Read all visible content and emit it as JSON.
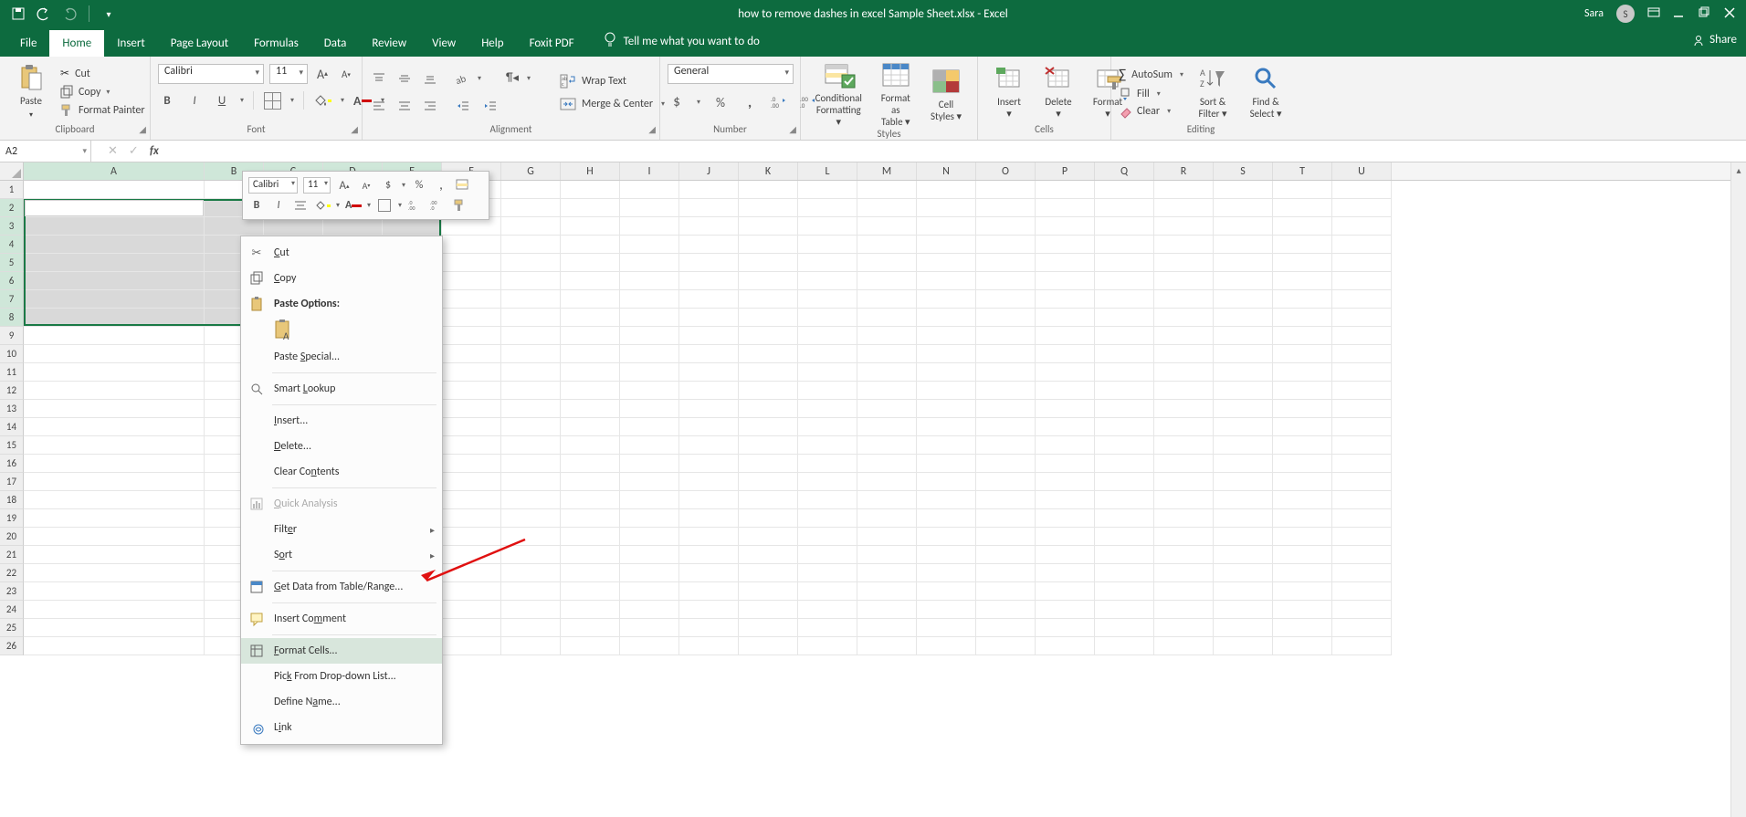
{
  "title": "how to remove dashes in excel Sample Sheet.xlsx  -  Excel",
  "user": {
    "name": "Sara",
    "initial": "S"
  },
  "tabs": [
    "File",
    "Home",
    "Insert",
    "Page Layout",
    "Formulas",
    "Data",
    "Review",
    "View",
    "Help",
    "Foxit PDF"
  ],
  "active_tab": "Home",
  "tell_me": "Tell me what you want to do",
  "share": "Share",
  "ribbon": {
    "paste": "Paste",
    "cut": "Cut",
    "copy": "Copy",
    "format_painter": "Format Painter",
    "clipboard_group": "Clipboard",
    "font_name": "Calibri",
    "font_size": "11",
    "font_group": "Font",
    "wrap": "Wrap Text",
    "merge": "Merge & Center",
    "alignment_group": "Alignment",
    "number_format": "General",
    "number_group": "Number",
    "cond_fmt_l1": "Conditional",
    "cond_fmt_l2": "Formatting",
    "fmt_table_l1": "Format as",
    "fmt_table_l2": "Table",
    "cell_styles_l1": "Cell",
    "cell_styles_l2": "Styles",
    "styles_group": "Styles",
    "insert": "Insert",
    "delete": "Delete",
    "format": "Format",
    "cells_group": "Cells",
    "autosum": "AutoSum",
    "fill": "Fill",
    "clear": "Clear",
    "sort_l1": "Sort &",
    "sort_l2": "Filter",
    "find_l1": "Find &",
    "find_l2": "Select",
    "editing_group": "Editing"
  },
  "name_box": "A2",
  "columns": [
    "A",
    "B",
    "C",
    "D",
    "E",
    "F",
    "G",
    "H",
    "I",
    "J",
    "K",
    "L",
    "M",
    "N",
    "O",
    "P",
    "Q",
    "R",
    "S",
    "T",
    "U"
  ],
  "col_width_first": 198,
  "col_width_rest": 65,
  "row_count": 26,
  "sel_cols": 5,
  "sel_rows_start": 2,
  "sel_rows_end": 8,
  "mini": {
    "font": "Calibri",
    "size": "11"
  },
  "ctx": {
    "cut": "Cut",
    "copy": "Copy",
    "paste_options": "Paste Options:",
    "paste_special": "Paste Special...",
    "smart_lookup": "Smart Lookup",
    "insert": "Insert...",
    "delete": "Delete...",
    "clear": "Clear Contents",
    "quick_analysis": "Quick Analysis",
    "filter": "Filter",
    "sort": "Sort",
    "get_data": "Get Data from Table/Range...",
    "insert_comment": "Insert Comment",
    "format_cells": "Format Cells...",
    "pick_list": "Pick From Drop-down List...",
    "define_name": "Define Name...",
    "link": "Link"
  }
}
